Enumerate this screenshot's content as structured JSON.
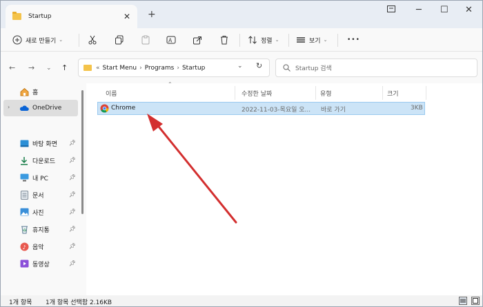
{
  "tab": {
    "title": "Startup"
  },
  "toolbar": {
    "new_label": "새로 만들기",
    "sort_label": "정렬",
    "view_label": "보기",
    "more_label": "•••"
  },
  "address": {
    "prefix": "«",
    "crumbs": [
      "Start Menu",
      "Programs",
      "Startup"
    ],
    "search_placeholder": "Startup 검색"
  },
  "sidebar": {
    "items": [
      {
        "label": "홈",
        "icon": "home-icon"
      },
      {
        "label": "OneDrive",
        "icon": "cloud-icon"
      },
      {
        "label": "바탕 화면",
        "icon": "desktop-icon"
      },
      {
        "label": "다운로드",
        "icon": "download-icon"
      },
      {
        "label": "내 PC",
        "icon": "monitor-icon"
      },
      {
        "label": "문서",
        "icon": "document-icon"
      },
      {
        "label": "사진",
        "icon": "picture-icon"
      },
      {
        "label": "휴지통",
        "icon": "recycle-bin-icon"
      },
      {
        "label": "음악",
        "icon": "music-icon"
      },
      {
        "label": "동영상",
        "icon": "video-icon"
      }
    ]
  },
  "columns": {
    "name": "이름",
    "modified": "수정한 날짜",
    "type": "유형",
    "size": "크기"
  },
  "files": [
    {
      "name": "Chrome",
      "modified": "2022-11-03-목요일 오...",
      "type": "바로 가기",
      "size": "3KB"
    }
  ],
  "status": {
    "count": "1개 항목",
    "selected": "1개 항목 선택함 2.16KB"
  },
  "colors": {
    "selection": "#cce4f7",
    "arrow": "#d32f2f",
    "accent": "#0067c0"
  }
}
